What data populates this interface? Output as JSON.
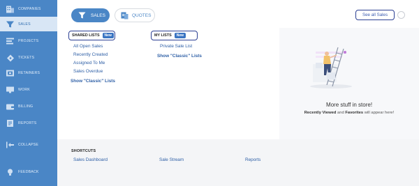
{
  "sidebar": {
    "items": [
      {
        "label": "COMPANIES",
        "icon": "building-icon"
      },
      {
        "label": "SALES",
        "icon": "funnel-icon",
        "active": true
      },
      {
        "label": "PROJECTS",
        "icon": "list-icon"
      },
      {
        "label": "TICKETS",
        "icon": "ticket-icon"
      },
      {
        "label": "RETAINERS",
        "icon": "retainer-icon"
      },
      {
        "label": "WORK",
        "icon": "monitor-icon"
      },
      {
        "label": "BILLING",
        "icon": "wallet-icon"
      },
      {
        "label": "REPORTS",
        "icon": "report-icon"
      },
      {
        "label": "COLLAPSE",
        "icon": "collapse-icon"
      },
      {
        "label": "FEEDBACK",
        "icon": "lightbulb-icon"
      }
    ]
  },
  "header": {
    "tabs": [
      {
        "label": "SALES",
        "icon": "funnel-icon",
        "active": true
      },
      {
        "label": "QUOTES",
        "icon": "quote-icon",
        "active": false
      }
    ],
    "see_all": "See all Sales"
  },
  "shared_lists": {
    "title": "SHARED LISTS",
    "badge": "New",
    "items": [
      "All Open Sales",
      "Recently Created",
      "Assigned To Me",
      "Sales Overdue"
    ],
    "classic": "Show \"Classic\" Lists"
  },
  "my_lists": {
    "title": "MY LISTS",
    "badge": "New",
    "items": [
      "Private Sale List"
    ],
    "classic": "Show \"Classic\" Lists"
  },
  "store": {
    "title": "More stuff in store!",
    "sub_bold_1": "Recently Viewed",
    "sub_mid": " and ",
    "sub_bold_2": "Favorites",
    "sub_end": " will appear here!"
  },
  "shortcuts": {
    "title": "SHORTCUTS",
    "items": [
      "Sales Dashboard",
      "Sale Stream",
      "Reports"
    ]
  },
  "colors": {
    "accent": "#4a86c6",
    "highlight_border": "#2b3f93",
    "link": "#2e5fa6"
  }
}
